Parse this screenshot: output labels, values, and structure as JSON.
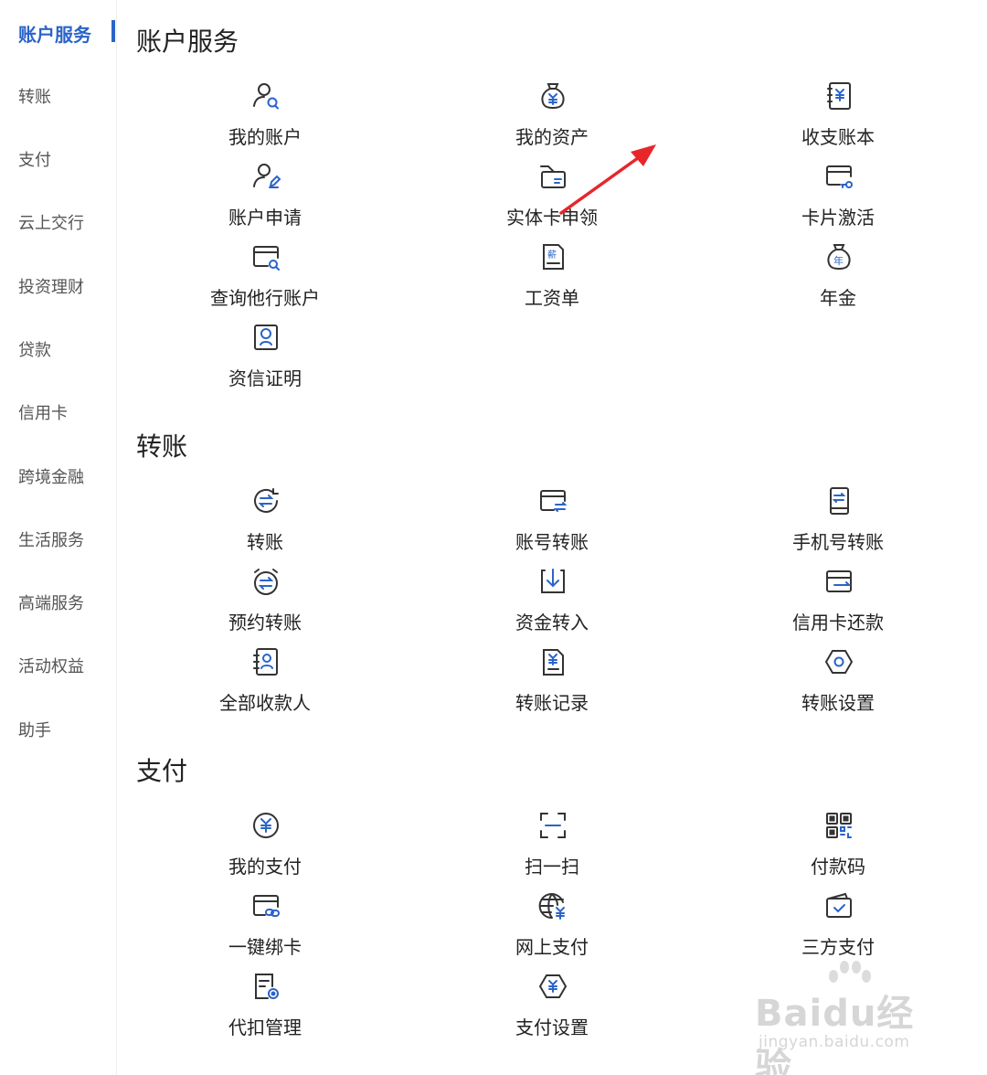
{
  "sidebar": {
    "items": [
      {
        "label": "账户服务",
        "active": true
      },
      {
        "label": "转账"
      },
      {
        "label": "支付"
      },
      {
        "label": "云上交行"
      },
      {
        "label": "投资理财"
      },
      {
        "label": "贷款"
      },
      {
        "label": "信用卡"
      },
      {
        "label": "跨境金融"
      },
      {
        "label": "生活服务"
      },
      {
        "label": "高端服务"
      },
      {
        "label": "活动权益"
      },
      {
        "label": "助手"
      }
    ]
  },
  "sections": [
    {
      "title": "账户服务",
      "tiles": [
        {
          "label": "我的账户",
          "icon": "account-search-icon"
        },
        {
          "label": "我的资产",
          "icon": "money-bag-yuan-icon"
        },
        {
          "label": "收支账本",
          "icon": "ledger-yuan-icon"
        },
        {
          "label": "账户申请",
          "icon": "account-edit-icon"
        },
        {
          "label": "实体卡申领",
          "icon": "card-hand-icon"
        },
        {
          "label": "卡片激活",
          "icon": "card-key-icon"
        },
        {
          "label": "查询他行账户",
          "icon": "card-search-icon"
        },
        {
          "label": "工资单",
          "icon": "salary-slip-icon"
        },
        {
          "label": "年金",
          "icon": "annuity-bag-icon"
        },
        {
          "label": "资信证明",
          "icon": "certificate-icon"
        }
      ]
    },
    {
      "title": "转账",
      "tiles": [
        {
          "label": "转账",
          "icon": "transfer-circle-icon"
        },
        {
          "label": "账号转账",
          "icon": "card-transfer-icon"
        },
        {
          "label": "手机号转账",
          "icon": "phone-transfer-icon"
        },
        {
          "label": "预约转账",
          "icon": "alarm-transfer-icon"
        },
        {
          "label": "资金转入",
          "icon": "fund-in-icon"
        },
        {
          "label": "信用卡还款",
          "icon": "credit-card-repay-icon"
        },
        {
          "label": "全部收款人",
          "icon": "payee-book-icon"
        },
        {
          "label": "转账记录",
          "icon": "transfer-record-icon"
        },
        {
          "label": "转账设置",
          "icon": "hexagon-settings-icon"
        }
      ]
    },
    {
      "title": "支付",
      "tiles": [
        {
          "label": "我的支付",
          "icon": "yuan-circle-icon"
        },
        {
          "label": "扫一扫",
          "icon": "scan-icon"
        },
        {
          "label": "付款码",
          "icon": "qr-code-icon"
        },
        {
          "label": "一键绑卡",
          "icon": "card-link-icon"
        },
        {
          "label": "网上支付",
          "icon": "globe-yuan-icon"
        },
        {
          "label": "三方支付",
          "icon": "wallet-check-icon"
        },
        {
          "label": "代扣管理",
          "icon": "doc-settings-icon"
        },
        {
          "label": "支付设置",
          "icon": "hexagon-yuan-icon"
        }
      ]
    }
  ],
  "watermark": {
    "main": "Baidu经验",
    "sub": "jingyan.baidu.com"
  },
  "colors": {
    "accent": "#2a64c8",
    "arrow": "#e8262a"
  }
}
